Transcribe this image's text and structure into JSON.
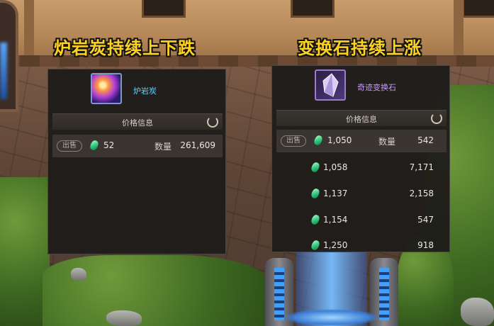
{
  "captions": {
    "left": "炉岩炭持续上下跌",
    "right": "变换石持续上涨"
  },
  "left_panel": {
    "item_name": "炉岩炭",
    "item_icon": "purple-orb-icon",
    "name_color": "#5fd6ff",
    "price_header": "价格信息",
    "sell_label": "出售",
    "sell_price": "52",
    "qty_label": "数量",
    "sell_qty": "261,609"
  },
  "right_panel": {
    "item_name": "奇迹变换石",
    "item_icon": "violet-crystal-icon",
    "name_color": "#c79bff",
    "price_header": "价格信息",
    "sell_label": "出售",
    "sell_price": "1,050",
    "qty_label": "数量",
    "sell_qty": "542",
    "listings": [
      {
        "price": "1,058",
        "qty": "7,171"
      },
      {
        "price": "1,137",
        "qty": "2,158"
      },
      {
        "price": "1,154",
        "qty": "547"
      },
      {
        "price": "1,250",
        "qty": "918"
      }
    ]
  },
  "colors": {
    "caption": "#ffd21f",
    "gem": "#2ec47a"
  }
}
